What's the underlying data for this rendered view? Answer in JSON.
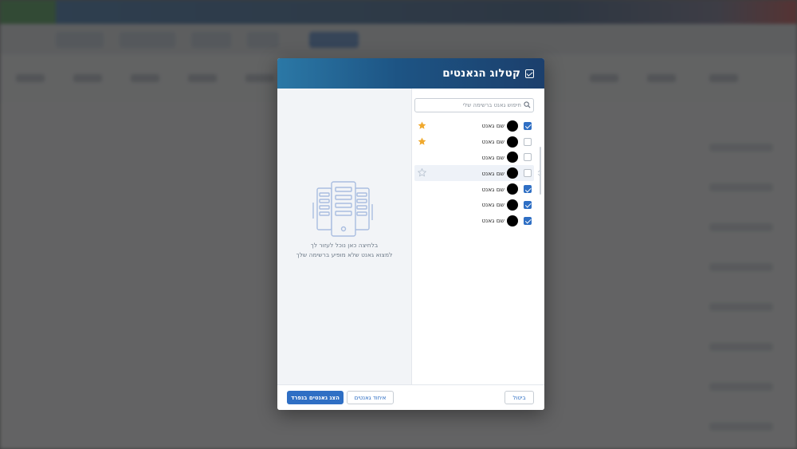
{
  "modal": {
    "title": "קטלוג הגאנטים",
    "search_placeholder": "חיפוש גאנט ברשימה שלי",
    "agents": [
      {
        "name": "שם גאנט",
        "checked": true,
        "favorite": true
      },
      {
        "name": "שם גאנט",
        "checked": false,
        "favorite": true
      },
      {
        "name": "שם גאנט",
        "checked": false,
        "favorite": false
      },
      {
        "name": "שם גאנט",
        "checked": false,
        "favorite": false,
        "hover": true
      },
      {
        "name": "שם גאנט",
        "checked": true,
        "favorite": false
      },
      {
        "name": "שם גאנט",
        "checked": true,
        "favorite": false
      },
      {
        "name": "שם גאנט",
        "checked": true,
        "favorite": false
      }
    ],
    "empty_state": {
      "line1": "בלחיצה כאן נוכל לעזור לך",
      "line2": "למצוא גאנט שלא מופיע ברשימה שלך"
    },
    "footer": {
      "cancel_label": "ביטול",
      "merge_label": "איחוד גאנטים",
      "show_label": "הצג גאנטים בנפרד"
    }
  },
  "colors": {
    "accent": "#2f6fc4",
    "header_dark": "#1c3f6c",
    "header_light": "#2b78a6",
    "star_filled": "#f0a92e",
    "star_empty": "#b8c3d0"
  },
  "icons": {
    "title": "checklist-icon",
    "search": "search-icon",
    "favorite": "star-icon",
    "empty": "servers-icon"
  }
}
